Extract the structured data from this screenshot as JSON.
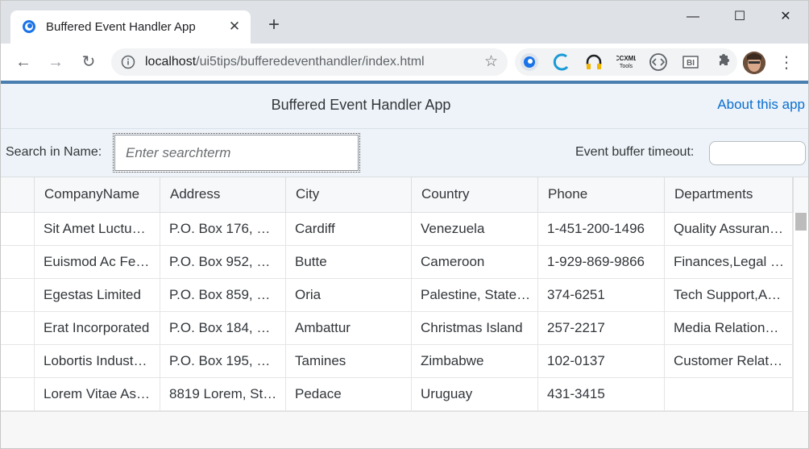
{
  "browser": {
    "tab_title": "Buffered Event Handler App",
    "tab_close": "✕",
    "new_tab": "+",
    "window": {
      "minimize": "—",
      "maximize": "☐",
      "close": "✕"
    },
    "nav": {
      "back": "←",
      "forward": "→",
      "reload": "↻"
    },
    "url_host": "localhost",
    "url_path": "/ui5tips/bufferedeventhandler/index.html",
    "star": "☆",
    "extensions": [
      "ui5-inspector-icon",
      "ui5-icon",
      "headphones-icon",
      "ccxml-tools-icon",
      "code-icon",
      "bi-icon",
      "puzzle-icon"
    ],
    "extensions_text": {
      "ccxml": "CCXML Tools",
      "code": "⟨·⟩",
      "bi": "BI"
    },
    "menu": "⋮"
  },
  "app": {
    "title": "Buffered Event Handler App",
    "about_link": "About this app",
    "search_label": "Search in Name:",
    "search_placeholder": "Enter searchterm",
    "timeout_label": "Event buffer timeout:",
    "timeout_value": ""
  },
  "table": {
    "columns": [
      "CompanyName",
      "Address",
      "City",
      "Country",
      "Phone",
      "Departments"
    ],
    "rows": [
      [
        "Sit Amet Luctu…",
        "P.O. Box 176, …",
        "Cardiff",
        "Venezuela",
        "1-451-200-1496",
        "Quality Assuran…"
      ],
      [
        "Euismod Ac Fe…",
        "P.O. Box 952, …",
        "Butte",
        "Cameroon",
        "1-929-869-9866",
        "Finances,Legal …"
      ],
      [
        "Egestas Limited",
        "P.O. Box 859, …",
        "Oria",
        "Palestine, State…",
        "374-6251",
        "Tech Support,A…"
      ],
      [
        "Erat Incorporated",
        "P.O. Box 184, …",
        "Ambattur",
        "Christmas Island",
        "257-2217",
        "Media Relation…"
      ],
      [
        "Lobortis Indust…",
        "P.O. Box 195, …",
        "Tamines",
        "Zimbabwe",
        "102-0137",
        "Customer Relat…"
      ],
      [
        "Lorem Vitae As…",
        "8819 Lorem, St…",
        "Pedace",
        "Uruguay",
        "431-3415",
        ""
      ]
    ]
  },
  "colors": {
    "accent": "#0a6ed1",
    "shell_bar": "#4a7eb0",
    "header_bg": "#edf3f8"
  }
}
